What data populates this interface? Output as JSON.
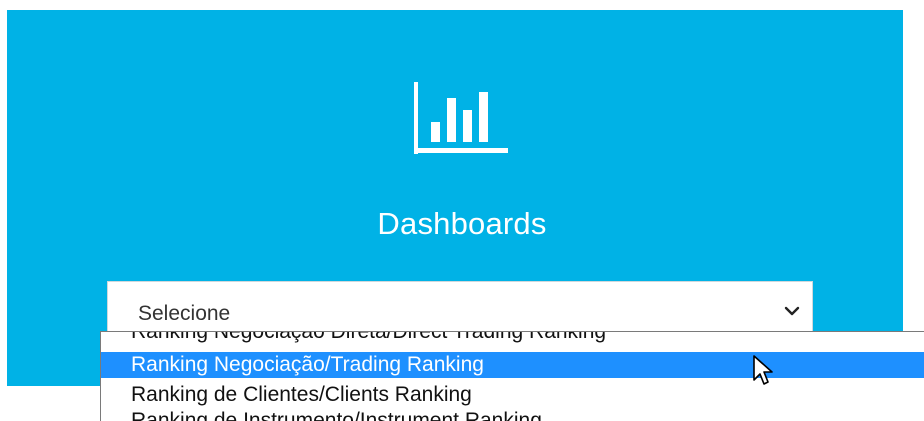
{
  "panel": {
    "background_color": "#00b2e6",
    "icon": "bar-chart-icon",
    "title": "Dashboards"
  },
  "select": {
    "current_value": "Selecione",
    "chevron_icon": "chevron-down-icon"
  },
  "dropdown": {
    "options": [
      {
        "label": "Ranking Negociação Direta/Direct Trading Ranking",
        "selected": false
      },
      {
        "label": "Ranking Negociação/Trading Ranking",
        "selected": true
      },
      {
        "label": "Ranking de Clientes/Clients Ranking",
        "selected": false
      },
      {
        "label": "Ranking de Instrumento/Instrument Ranking",
        "selected": false
      }
    ],
    "highlight_color": "#1e90ff"
  },
  "cursor": {
    "icon": "mouse-pointer-icon"
  }
}
